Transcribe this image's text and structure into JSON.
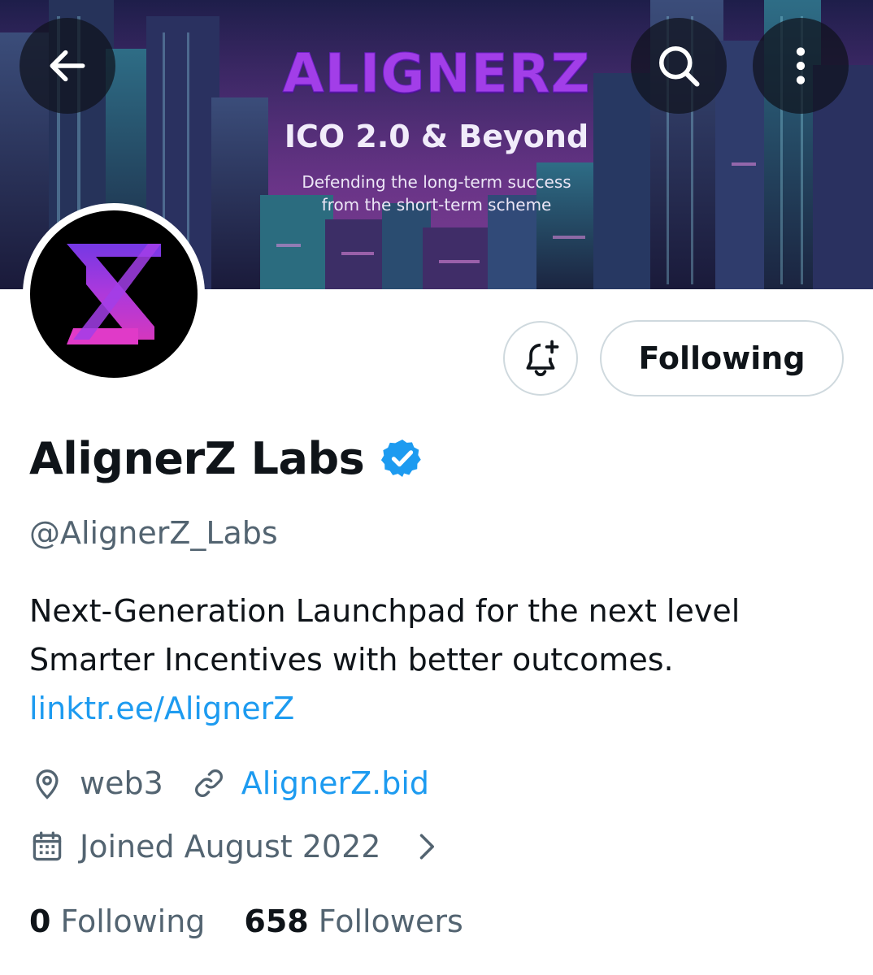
{
  "banner": {
    "brand": "ALIGNERZ",
    "tagline": "ICO 2.0 & Beyond",
    "subtitle_line1": "Defending the long-term success",
    "subtitle_line2": "from the short-term scheme"
  },
  "header_buttons": {
    "back_icon": "arrow-left-icon",
    "search_icon": "search-icon",
    "more_icon": "more-vertical-icon"
  },
  "actions": {
    "notify_icon": "bell-plus-icon",
    "following_label": "Following"
  },
  "profile": {
    "display_name": "AlignerZ Labs",
    "verified": true,
    "handle": "@AlignerZ_Labs",
    "bio_line1": "Next-Generation Launchpad for the next level",
    "bio_line2": "Smarter Incentives with better outcomes.",
    "bio_link": "linktr.ee/AlignerZ",
    "location": "web3",
    "website": "AlignerZ.bid",
    "joined": "Joined August 2022"
  },
  "stats": {
    "following_count": "0",
    "following_label": "Following",
    "followers_count": "658",
    "followers_label": "Followers"
  },
  "colors": {
    "link": "#1d9bf0",
    "secondary_text": "#536471",
    "primary_text": "#0f1419",
    "verified": "#1d9bf0",
    "brand_purple": "#a23ee8"
  }
}
